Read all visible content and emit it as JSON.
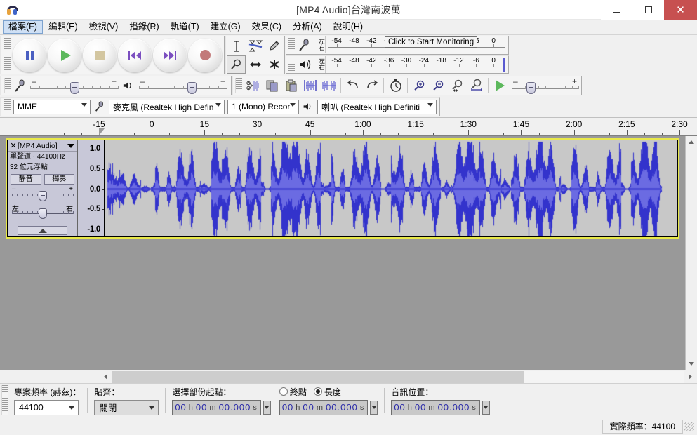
{
  "window": {
    "title": "[MP4 Audio]台灣南波萬",
    "app_icon": "headphones-icon",
    "minimize_label": "",
    "maximize_label": "",
    "close_label": "✕"
  },
  "menubar": {
    "items": [
      {
        "label": "檔案(F)",
        "active": true
      },
      {
        "label": "編輯(E)",
        "active": false
      },
      {
        "label": "檢視(V)",
        "active": false
      },
      {
        "label": "播錄(R)",
        "active": false
      },
      {
        "label": "軌道(T)",
        "active": false
      },
      {
        "label": "建立(G)",
        "active": false
      },
      {
        "label": "效果(C)",
        "active": false
      },
      {
        "label": "分析(A)",
        "active": false
      },
      {
        "label": "說明(H)",
        "active": false
      }
    ]
  },
  "transport": {
    "buttons": [
      {
        "name": "pause-button",
        "icon": "pause-icon"
      },
      {
        "name": "play-button",
        "icon": "play-icon"
      },
      {
        "name": "stop-button",
        "icon": "stop-icon"
      },
      {
        "name": "skip-to-start-button",
        "icon": "skip-start-icon"
      },
      {
        "name": "skip-to-end-button",
        "icon": "skip-end-icon"
      },
      {
        "name": "record-button",
        "icon": "record-icon"
      }
    ]
  },
  "tools": {
    "row1": [
      {
        "name": "selection-tool",
        "icon": "i-beam-icon",
        "selected": false
      },
      {
        "name": "envelope-tool",
        "icon": "envelope-icon",
        "selected": false
      },
      {
        "name": "draw-tool",
        "icon": "pencil-icon",
        "selected": false
      }
    ],
    "row2": [
      {
        "name": "zoom-tool",
        "icon": "magnifier-icon",
        "selected": true
      },
      {
        "name": "time-shift-tool",
        "icon": "left-right-arrow-icon",
        "selected": false
      },
      {
        "name": "multi-tool",
        "icon": "asterisk-icon",
        "selected": false
      }
    ]
  },
  "meters": {
    "scale_labels": [
      "-54",
      "-48",
      "-42",
      "-36",
      "-30",
      "-24",
      "-18",
      "-12",
      "-6",
      "0"
    ],
    "record": {
      "icon": "microphone-icon",
      "left_label": "左",
      "right_label": "右",
      "tooltip": "Click to Start Monitoring"
    },
    "play": {
      "icon": "speaker-icon",
      "left_label": "左",
      "right_label": "右"
    }
  },
  "mixer": {
    "input_icon": "microphone-icon",
    "output_icon": "speaker-icon",
    "minus": "–",
    "plus": "+",
    "input_value_pct": 55,
    "output_value_pct": 60
  },
  "edit_toolbar": {
    "buttons": [
      {
        "name": "cut-button",
        "icon": "scissors-icon"
      },
      {
        "name": "copy-button",
        "icon": "copy-icon"
      },
      {
        "name": "paste-button",
        "icon": "paste-icon"
      },
      {
        "name": "trim-button",
        "icon": "trim-audio-icon"
      },
      {
        "name": "silence-button",
        "icon": "silence-audio-icon"
      },
      {
        "name": "undo-button",
        "icon": "undo-arrow-icon"
      },
      {
        "name": "redo-button",
        "icon": "redo-arrow-icon"
      },
      {
        "name": "sync-lock-button",
        "icon": "stopwatch-icon"
      },
      {
        "name": "zoom-in-button",
        "icon": "zoom-in-icon"
      },
      {
        "name": "zoom-out-button",
        "icon": "zoom-out-icon"
      },
      {
        "name": "fit-selection-button",
        "icon": "fit-selection-icon"
      },
      {
        "name": "fit-project-button",
        "icon": "fit-project-icon"
      },
      {
        "name": "play-at-speed-button",
        "icon": "play-icon"
      }
    ]
  },
  "devices": {
    "host": {
      "label": "MME",
      "name": "audio-host-select"
    },
    "input_icon": "microphone-icon",
    "input": {
      "label": "麥克風 (Realtek High Defin",
      "name": "recording-device-select"
    },
    "channels": {
      "label": "1 (Mono) Recor",
      "name": "recording-channels-select"
    },
    "output_icon": "speaker-icon",
    "output": {
      "label": "喇叭 (Realtek High Definiti",
      "name": "playback-device-select"
    }
  },
  "timeline": {
    "labels": [
      "-15",
      "0",
      "15",
      "30",
      "45",
      "1:00",
      "1:15",
      "1:30",
      "1:45",
      "2:00",
      "2:15",
      "2:30"
    ],
    "playhead_position": "0"
  },
  "track": {
    "name": "[MP4 Audio]",
    "close_glyph": "✕",
    "info_line1": "單聲道 · 44100Hz",
    "info_line2": "32 位元浮點",
    "mute_label": "靜音",
    "solo_label": "獨奏",
    "gain_minus": "–",
    "gain_plus": "+",
    "pan_left": "左",
    "pan_right": "右",
    "vertical_ruler_labels": [
      "1.0",
      "0.5",
      "0.0",
      "-0.5",
      "-1.0"
    ]
  },
  "colors": {
    "waveform_peak": "#3333cc",
    "waveform_rms": "#6b6be2",
    "waveform_bg": "#c8c8c8",
    "track_border": "#e8e84a",
    "panel_bg": "#c8c8d8",
    "background": "#999999",
    "close_button": "#c75050",
    "menu_highlight": "#cfe0f5"
  },
  "selection_bar": {
    "project_rate_label": "專案頻率 (赫茲)：",
    "project_rate_value": "44100",
    "snap_label": "貼齊：",
    "snap_value": "關閉",
    "selection_start_label": "選擇部份起點：",
    "selection_start_value": {
      "h": "00",
      "m": "00",
      "s": "00.000"
    },
    "end_radio_label": "終點",
    "length_radio_label": "長度",
    "end_selected": false,
    "length_selected": true,
    "selection_length_value": {
      "h": "00",
      "m": "00",
      "s": "00.000"
    },
    "audio_position_label": "音訊位置：",
    "audio_position_value": {
      "h": "00",
      "m": "00",
      "s": "00.000"
    },
    "unit_h": "h",
    "unit_m": "m",
    "unit_s": "s"
  },
  "statusbar": {
    "actual_rate": "實際頻率：44100"
  }
}
